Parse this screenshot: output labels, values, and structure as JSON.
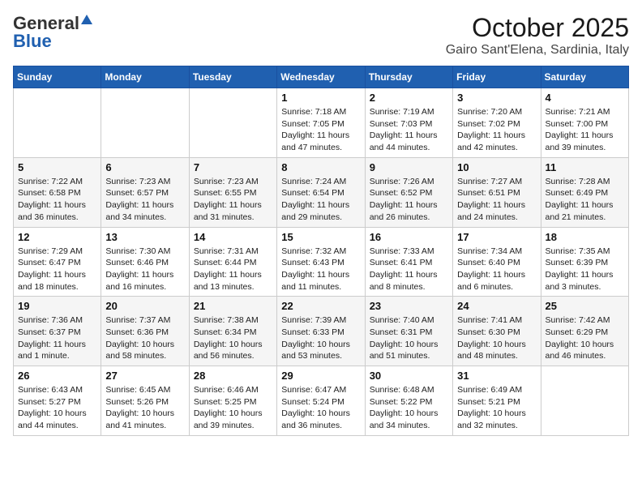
{
  "header": {
    "logo_general": "General",
    "logo_blue": "Blue",
    "month": "October 2025",
    "location": "Gairo Sant'Elena, Sardinia, Italy"
  },
  "weekdays": [
    "Sunday",
    "Monday",
    "Tuesday",
    "Wednesday",
    "Thursday",
    "Friday",
    "Saturday"
  ],
  "weeks": [
    [
      {
        "day": "",
        "info": ""
      },
      {
        "day": "",
        "info": ""
      },
      {
        "day": "",
        "info": ""
      },
      {
        "day": "1",
        "info": "Sunrise: 7:18 AM\nSunset: 7:05 PM\nDaylight: 11 hours and 47 minutes."
      },
      {
        "day": "2",
        "info": "Sunrise: 7:19 AM\nSunset: 7:03 PM\nDaylight: 11 hours and 44 minutes."
      },
      {
        "day": "3",
        "info": "Sunrise: 7:20 AM\nSunset: 7:02 PM\nDaylight: 11 hours and 42 minutes."
      },
      {
        "day": "4",
        "info": "Sunrise: 7:21 AM\nSunset: 7:00 PM\nDaylight: 11 hours and 39 minutes."
      }
    ],
    [
      {
        "day": "5",
        "info": "Sunrise: 7:22 AM\nSunset: 6:58 PM\nDaylight: 11 hours and 36 minutes."
      },
      {
        "day": "6",
        "info": "Sunrise: 7:23 AM\nSunset: 6:57 PM\nDaylight: 11 hours and 34 minutes."
      },
      {
        "day": "7",
        "info": "Sunrise: 7:23 AM\nSunset: 6:55 PM\nDaylight: 11 hours and 31 minutes."
      },
      {
        "day": "8",
        "info": "Sunrise: 7:24 AM\nSunset: 6:54 PM\nDaylight: 11 hours and 29 minutes."
      },
      {
        "day": "9",
        "info": "Sunrise: 7:26 AM\nSunset: 6:52 PM\nDaylight: 11 hours and 26 minutes."
      },
      {
        "day": "10",
        "info": "Sunrise: 7:27 AM\nSunset: 6:51 PM\nDaylight: 11 hours and 24 minutes."
      },
      {
        "day": "11",
        "info": "Sunrise: 7:28 AM\nSunset: 6:49 PM\nDaylight: 11 hours and 21 minutes."
      }
    ],
    [
      {
        "day": "12",
        "info": "Sunrise: 7:29 AM\nSunset: 6:47 PM\nDaylight: 11 hours and 18 minutes."
      },
      {
        "day": "13",
        "info": "Sunrise: 7:30 AM\nSunset: 6:46 PM\nDaylight: 11 hours and 16 minutes."
      },
      {
        "day": "14",
        "info": "Sunrise: 7:31 AM\nSunset: 6:44 PM\nDaylight: 11 hours and 13 minutes."
      },
      {
        "day": "15",
        "info": "Sunrise: 7:32 AM\nSunset: 6:43 PM\nDaylight: 11 hours and 11 minutes."
      },
      {
        "day": "16",
        "info": "Sunrise: 7:33 AM\nSunset: 6:41 PM\nDaylight: 11 hours and 8 minutes."
      },
      {
        "day": "17",
        "info": "Sunrise: 7:34 AM\nSunset: 6:40 PM\nDaylight: 11 hours and 6 minutes."
      },
      {
        "day": "18",
        "info": "Sunrise: 7:35 AM\nSunset: 6:39 PM\nDaylight: 11 hours and 3 minutes."
      }
    ],
    [
      {
        "day": "19",
        "info": "Sunrise: 7:36 AM\nSunset: 6:37 PM\nDaylight: 11 hours and 1 minute."
      },
      {
        "day": "20",
        "info": "Sunrise: 7:37 AM\nSunset: 6:36 PM\nDaylight: 10 hours and 58 minutes."
      },
      {
        "day": "21",
        "info": "Sunrise: 7:38 AM\nSunset: 6:34 PM\nDaylight: 10 hours and 56 minutes."
      },
      {
        "day": "22",
        "info": "Sunrise: 7:39 AM\nSunset: 6:33 PM\nDaylight: 10 hours and 53 minutes."
      },
      {
        "day": "23",
        "info": "Sunrise: 7:40 AM\nSunset: 6:31 PM\nDaylight: 10 hours and 51 minutes."
      },
      {
        "day": "24",
        "info": "Sunrise: 7:41 AM\nSunset: 6:30 PM\nDaylight: 10 hours and 48 minutes."
      },
      {
        "day": "25",
        "info": "Sunrise: 7:42 AM\nSunset: 6:29 PM\nDaylight: 10 hours and 46 minutes."
      }
    ],
    [
      {
        "day": "26",
        "info": "Sunrise: 6:43 AM\nSunset: 5:27 PM\nDaylight: 10 hours and 44 minutes."
      },
      {
        "day": "27",
        "info": "Sunrise: 6:45 AM\nSunset: 5:26 PM\nDaylight: 10 hours and 41 minutes."
      },
      {
        "day": "28",
        "info": "Sunrise: 6:46 AM\nSunset: 5:25 PM\nDaylight: 10 hours and 39 minutes."
      },
      {
        "day": "29",
        "info": "Sunrise: 6:47 AM\nSunset: 5:24 PM\nDaylight: 10 hours and 36 minutes."
      },
      {
        "day": "30",
        "info": "Sunrise: 6:48 AM\nSunset: 5:22 PM\nDaylight: 10 hours and 34 minutes."
      },
      {
        "day": "31",
        "info": "Sunrise: 6:49 AM\nSunset: 5:21 PM\nDaylight: 10 hours and 32 minutes."
      },
      {
        "day": "",
        "info": ""
      }
    ]
  ]
}
